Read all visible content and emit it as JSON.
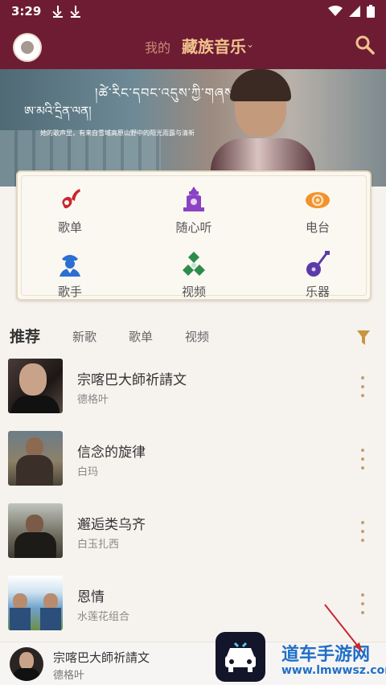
{
  "status_bar": {
    "time": "3:29"
  },
  "header": {
    "tab_mine": "我的",
    "tab_music": "藏族音乐"
  },
  "banner": {
    "tibetan_line1": "།ཚེ་རིང་དབང་འདུས་ཀྱི་གཞས།",
    "tibetan_line2": "ཨ་མའི་དྲིན་ལན།",
    "caption": "她的歌声里，有来自雪域高原山野中的阳光雨露与清新"
  },
  "categories": [
    {
      "label": "歌单",
      "icon": "music-note-icon",
      "color": "#c9262d"
    },
    {
      "label": "随心听",
      "icon": "stupa-icon",
      "color": "#8b43c4"
    },
    {
      "label": "电台",
      "icon": "cloud-icon",
      "color": "#f0932c"
    },
    {
      "label": "歌手",
      "icon": "singer-icon",
      "color": "#2b6fd1"
    },
    {
      "label": "视频",
      "icon": "knot-icon",
      "color": "#2d8c4c"
    },
    {
      "label": "乐器",
      "icon": "lute-icon",
      "color": "#5b3aa8"
    }
  ],
  "tabs": [
    {
      "label": "推荐",
      "active": true
    },
    {
      "label": "新歌",
      "active": false
    },
    {
      "label": "歌单",
      "active": false
    },
    {
      "label": "视频",
      "active": false
    }
  ],
  "songs": [
    {
      "title": "宗喀巴大師祈請文",
      "artist": "德格叶"
    },
    {
      "title": "信念的旋律",
      "artist": "白玛"
    },
    {
      "title": "邂逅类乌齐",
      "artist": "白玉扎西"
    },
    {
      "title": "恩情",
      "artist": "水莲花组合"
    }
  ],
  "player": {
    "title": "宗喀巴大師祈請文",
    "artist": "德格叶"
  },
  "watermark": {
    "text": "道车手游网",
    "url": "www.lmwwsz.com"
  },
  "colors": {
    "header_bg": "#6e1c34",
    "accent_gold": "#f0c28d",
    "page_bg": "#f6f3ef"
  }
}
